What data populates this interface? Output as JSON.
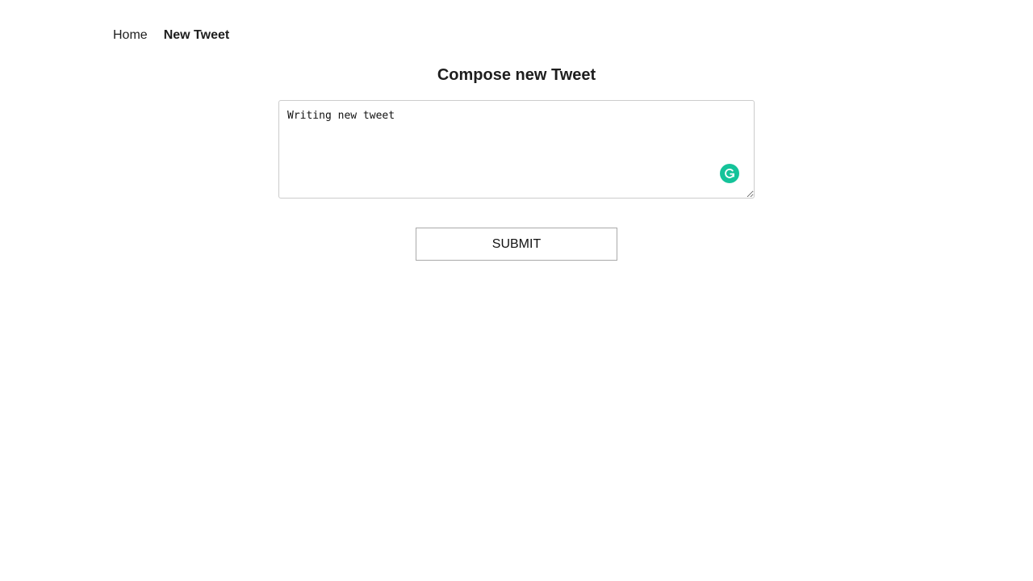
{
  "nav": {
    "home_label": "Home",
    "new_tweet_label": "New Tweet"
  },
  "main": {
    "title": "Compose new Tweet",
    "tweet_text": "Writing new tweet",
    "submit_label": "SUBMIT"
  },
  "icons": {
    "grammarly": "grammarly-icon"
  },
  "colors": {
    "grammarly_green": "#15c39a",
    "text": "#1e1e1e",
    "input_border": "#cccccc",
    "button_border": "#a9a9a9"
  }
}
